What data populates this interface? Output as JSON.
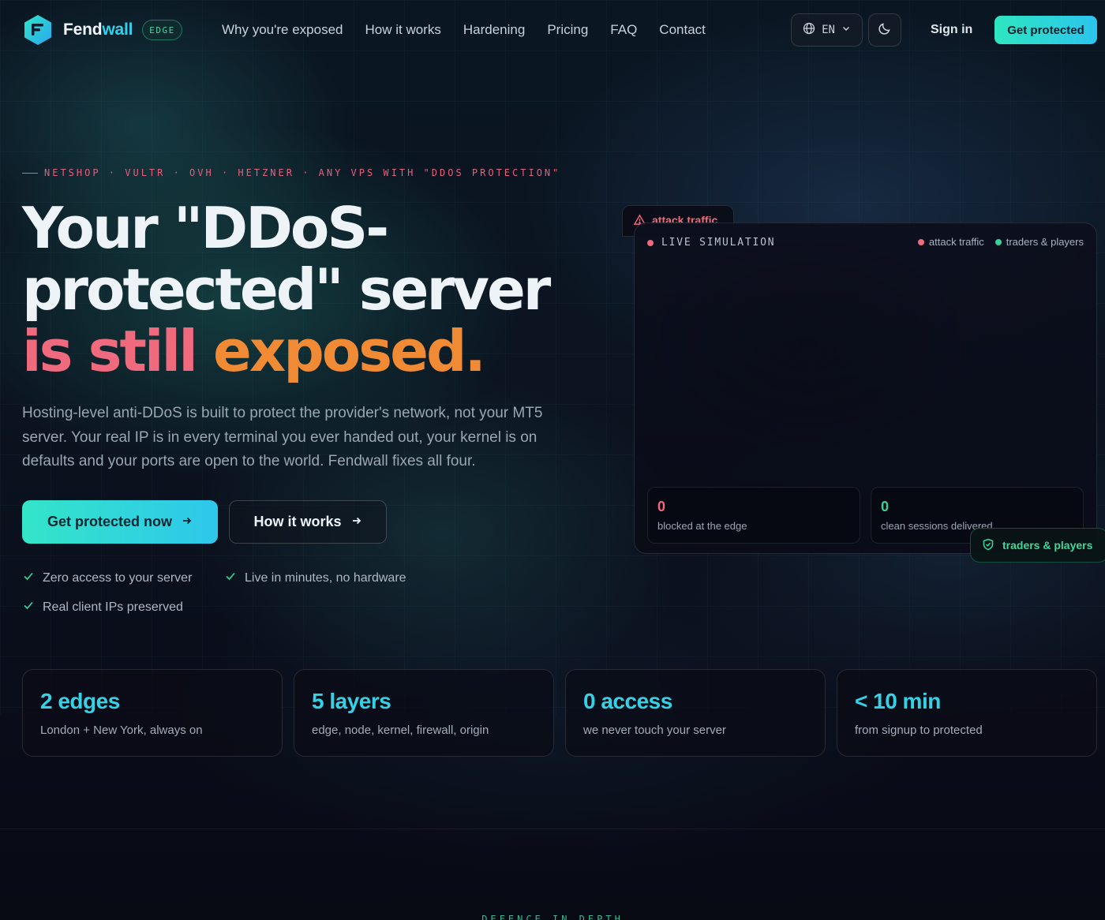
{
  "brand": {
    "name_part1": "Fend",
    "name_part2": "wall",
    "badge": "EDGE",
    "accent": "#2fd3ee"
  },
  "nav": {
    "links": [
      "Why you're exposed",
      "How it works",
      "Hardening",
      "Pricing",
      "FAQ",
      "Contact"
    ],
    "language": "EN",
    "sign_in": "Sign in",
    "cta": "Get protected"
  },
  "hero": {
    "eyebrow": "NETSHOP · VULTR · OVH · HETZNER · ANY VPS WITH \"DDOS PROTECTION\"",
    "headline": {
      "line1": "Your \"DDoS-",
      "line2": "protected\" server",
      "line3_part1": "is still ",
      "line3_part2": "exposed."
    },
    "lede": "Hosting-level anti-DDoS is built to protect the provider's network, not your MT5 server. Your real IP is in every terminal you ever handed out, your kernel is on defaults and your ports are open to the world. Fendwall fixes all four.",
    "primary_button": "Get protected now",
    "secondary_button": "How it works",
    "features": [
      "Zero access to your server",
      "Live in minutes, no hardware",
      "Real client IPs preserved"
    ]
  },
  "simulation": {
    "alert_tab": "attack traffic",
    "title": "LIVE SIMULATION",
    "legend": [
      {
        "label": "attack traffic",
        "color": "#f06a7e"
      },
      {
        "label": "traders & players",
        "color": "#34d399"
      }
    ],
    "blocked": {
      "value": "0",
      "label": "blocked at the edge",
      "color": "#f06a7e"
    },
    "clean": {
      "value": "0",
      "label": "clean sessions delivered",
      "color": "#34d399"
    },
    "chip": "traders & players"
  },
  "stats": [
    {
      "value": "2 edges",
      "label": "London + New York, always on"
    },
    {
      "value": "5 layers",
      "label": "edge, node, kernel, firewall, origin"
    },
    {
      "value": "0 access",
      "label": "we never touch your server"
    },
    {
      "value": "< 10 min",
      "label": "from signup to protected"
    }
  ],
  "next_section": {
    "eyebrow": "DEFENCE IN DEPTH"
  }
}
